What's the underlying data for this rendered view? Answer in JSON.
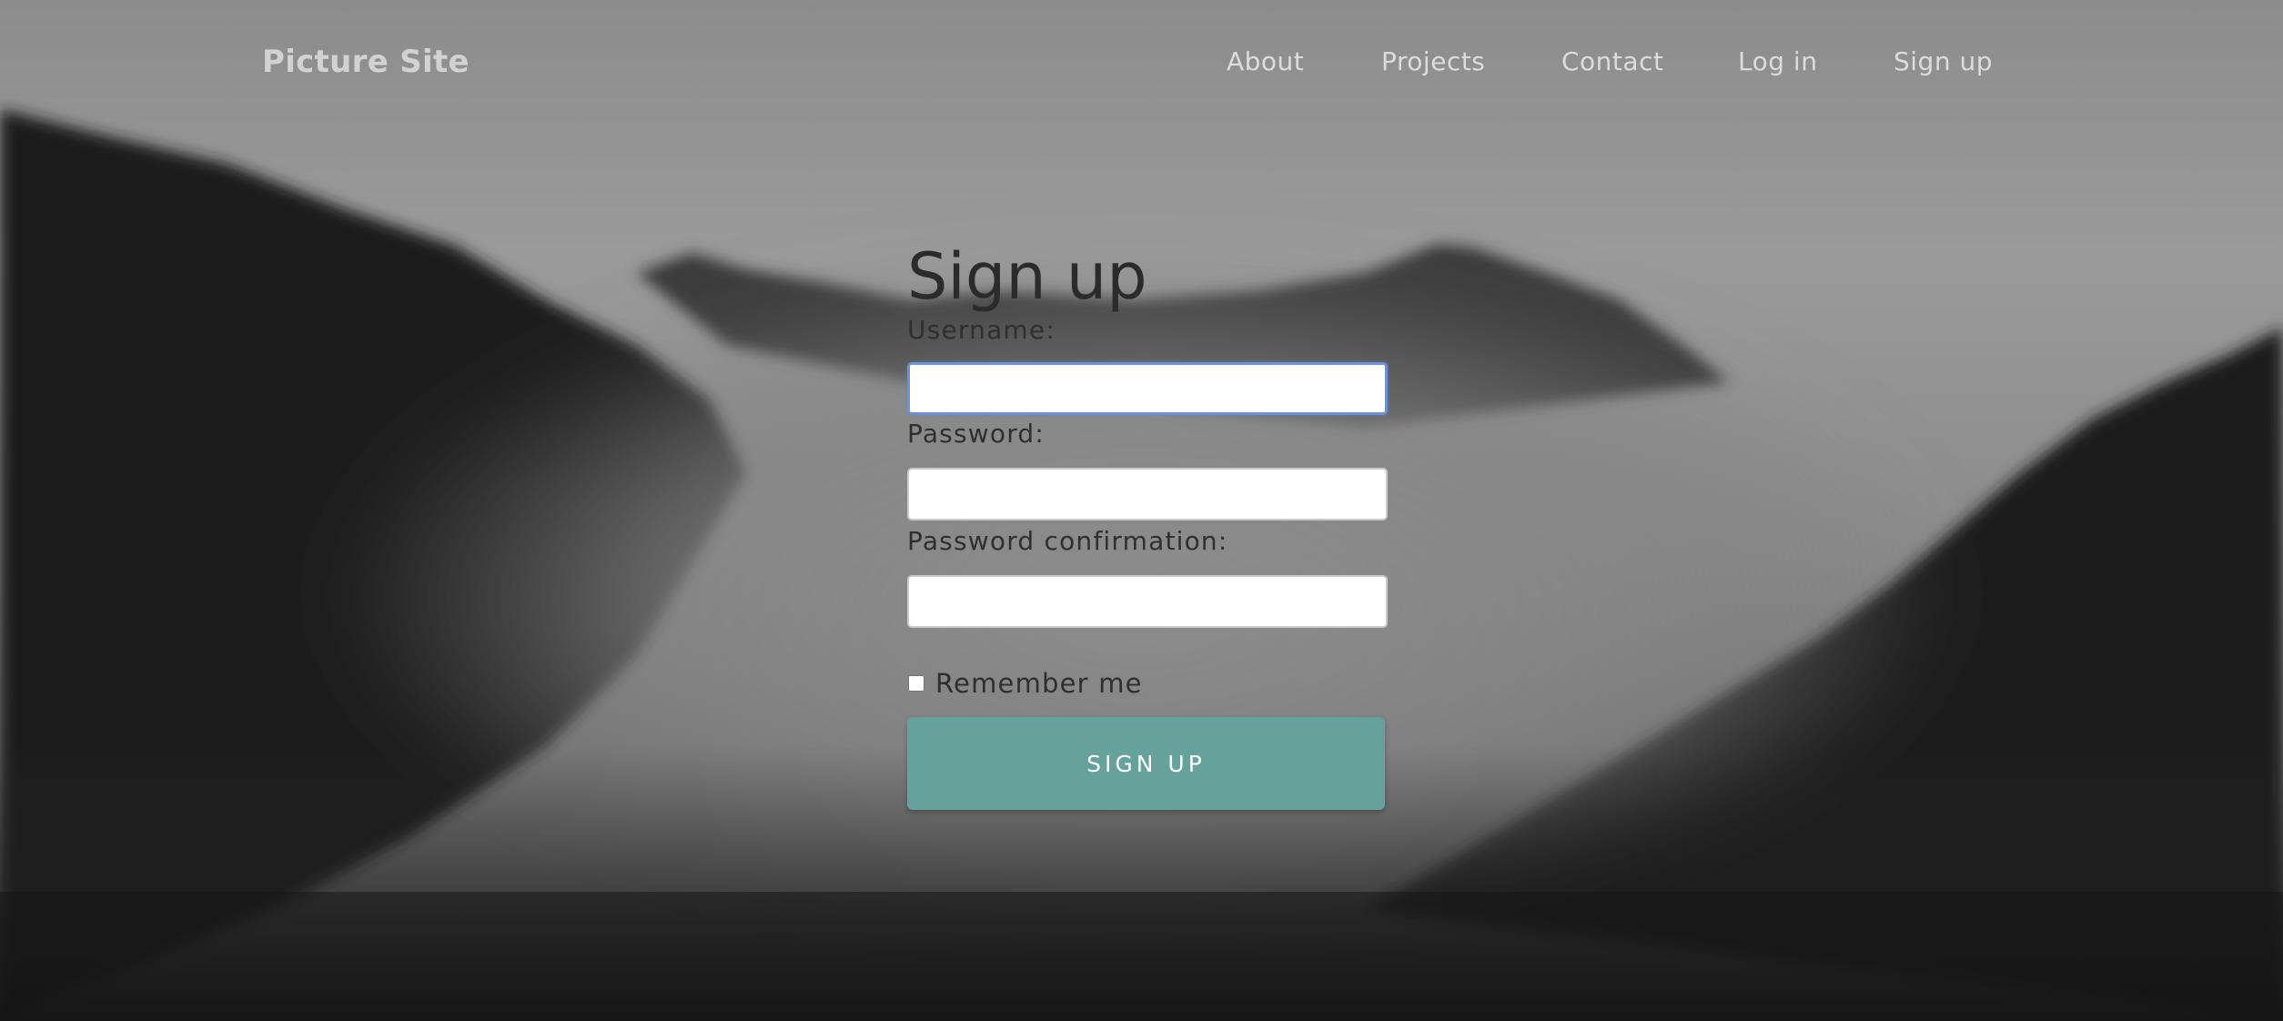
{
  "nav": {
    "brand": "Picture Site",
    "links": [
      {
        "label": "About"
      },
      {
        "label": "Projects"
      },
      {
        "label": "Contact"
      },
      {
        "label": "Log in"
      },
      {
        "label": "Sign up"
      }
    ]
  },
  "form": {
    "title": "Sign up",
    "username_label": "Username:",
    "username_value": "",
    "password_label": "Password:",
    "password_value": "",
    "password_confirmation_label": "Password confirmation:",
    "password_confirmation_value": "",
    "remember_label": "Remember me",
    "remember_checked": false,
    "submit_label": "SIGN UP"
  },
  "colors": {
    "button": "#66a29c",
    "focus_ring": "#6d90d6",
    "text_dark": "#2b2b2b",
    "nav_text": "#dcdcdc"
  }
}
